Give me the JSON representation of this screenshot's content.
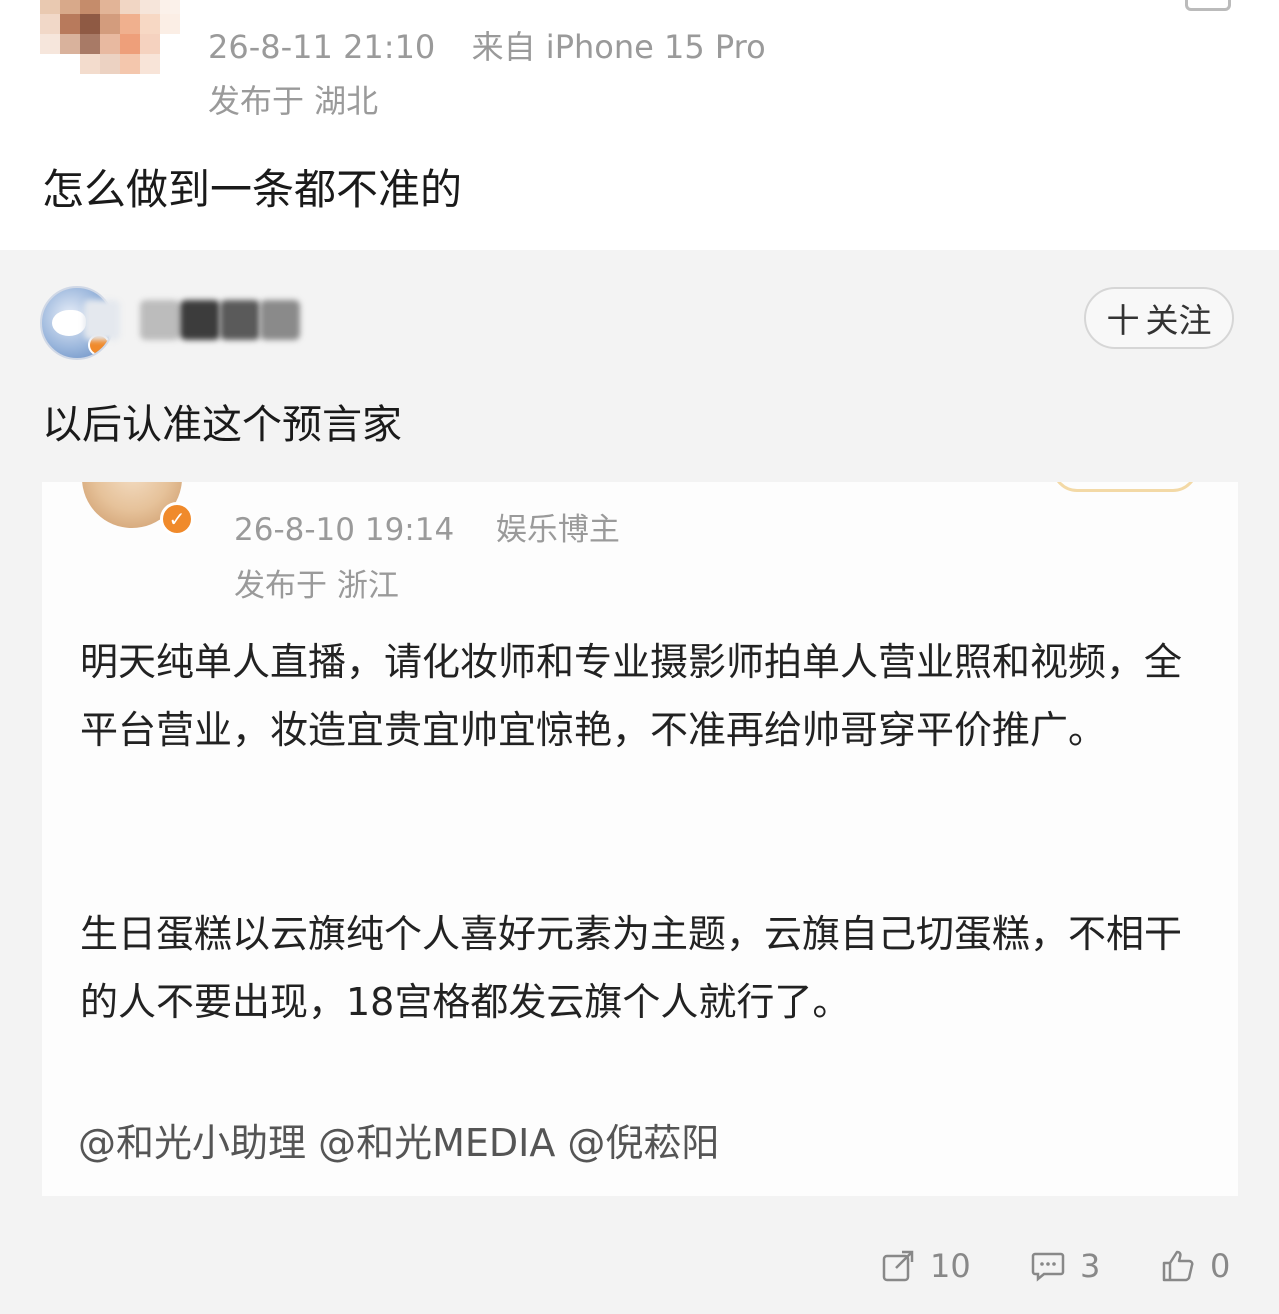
{
  "post": {
    "timestamp": "26-8-11 21:10",
    "source": "来自 iPhone 15 Pro",
    "location": "发布于 湖北",
    "text": "怎么做到一条都不准的"
  },
  "repost": {
    "follow_label": "关注",
    "follow_plus": "十",
    "text": "以后认准这个预言家"
  },
  "quoted": {
    "timestamp": "26-8-10 19:14",
    "tag": "娱乐博主",
    "location": "发布于 浙江",
    "para1": "明天纯单人直播，请化妆师和专业摄影师拍单人营业照和视频，全平台营业，妆造宜贵宜帅宜惊艳，不准再给帅哥穿平价推广。",
    "para2": "生日蛋糕以云旗纯个人喜好元素为主题，云旗自己切蛋糕，不相干的人不要出现，18宫格都发云旗个人就行了。",
    "mentions": "@和光小助理 @和光MEDIA @倪菘阳"
  },
  "actions": {
    "share_count": "10",
    "comment_count": "3",
    "like_count": "0"
  },
  "icons": [
    "share-icon",
    "comment-icon",
    "like-icon",
    "verified-badge-icon",
    "plus-icon"
  ],
  "colors": {
    "page_bg": "#f3f3f3",
    "card_bg": "#ffffff",
    "meta_gray": "#9a9a9a",
    "badge_orange": "#f08a2b"
  }
}
